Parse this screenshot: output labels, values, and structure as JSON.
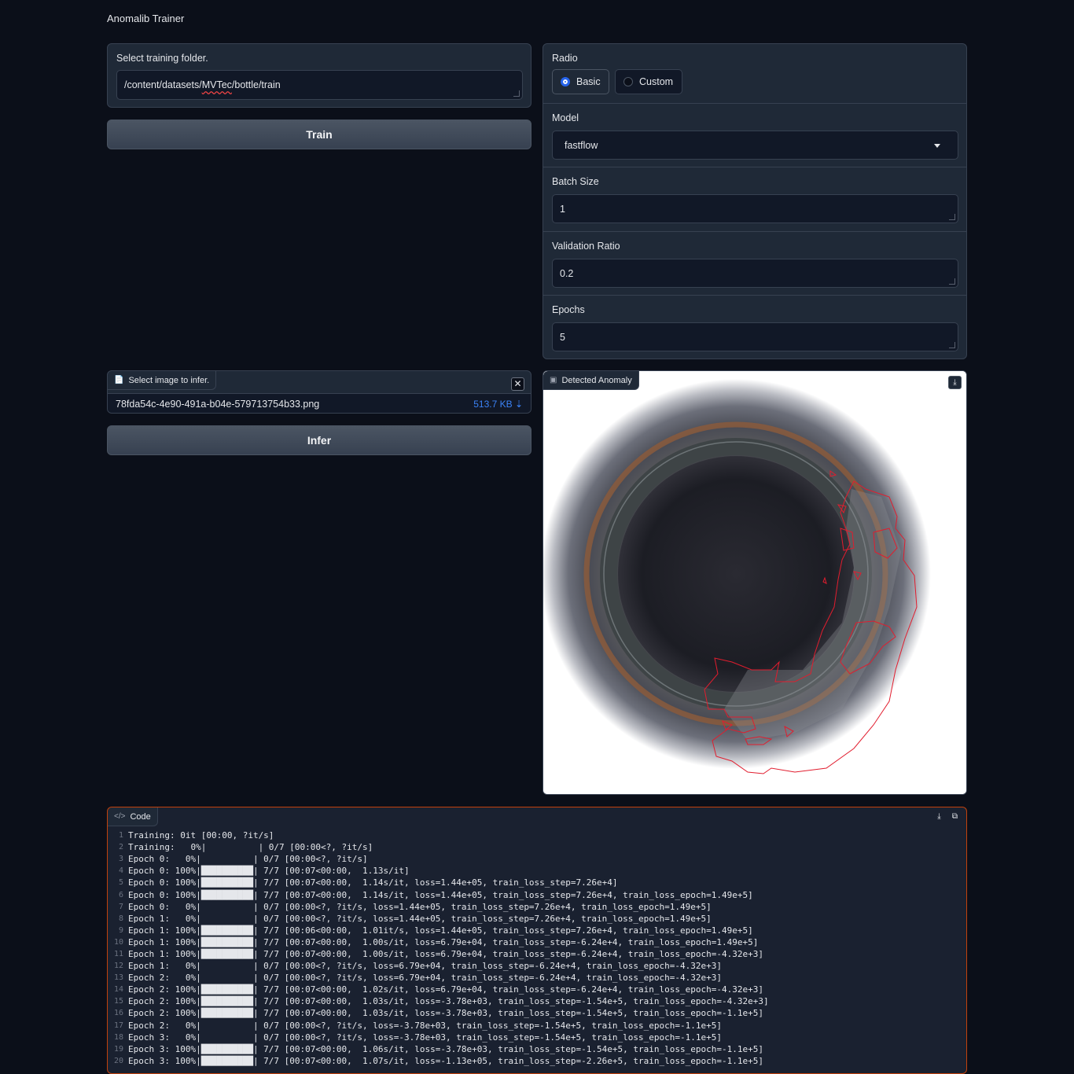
{
  "app": {
    "title": "Anomalib Trainer"
  },
  "train": {
    "folder_label": "Select training folder.",
    "folder_value_prefix": "/content/datasets/",
    "folder_value_spell": "MVTec",
    "folder_value_suffix": "/bottle/train",
    "train_button": "Train"
  },
  "settings": {
    "radio_label": "Radio",
    "radio_options": [
      "Basic",
      "Custom"
    ],
    "radio_selected": "Basic",
    "model_label": "Model",
    "model_value": "fastflow",
    "batch_label": "Batch Size",
    "batch_value": "1",
    "val_label": "Validation Ratio",
    "val_value": "0.2",
    "epochs_label": "Epochs",
    "epochs_value": "5"
  },
  "infer": {
    "file_label": "Select image to infer.",
    "file_name": "78fda54c-4e90-491a-b04e-579713754b33.png",
    "file_size": "513.7 KB ⇣",
    "infer_button": "Infer"
  },
  "result": {
    "label": "Detected Anomaly"
  },
  "code": {
    "label": "Code",
    "lines": [
      "Training: 0it [00:00, ?it/s]",
      "Training:   0%|          | 0/7 [00:00<?, ?it/s]",
      "Epoch 0:   0%|          | 0/7 [00:00<?, ?it/s]",
      "Epoch 0: 100%|██████████| 7/7 [00:07<00:00,  1.13s/it]",
      "Epoch 0: 100%|██████████| 7/7 [00:07<00:00,  1.14s/it, loss=1.44e+05, train_loss_step=7.26e+4]",
      "Epoch 0: 100%|██████████| 7/7 [00:07<00:00,  1.14s/it, loss=1.44e+05, train_loss_step=7.26e+4, train_loss_epoch=1.49e+5]",
      "Epoch 0:   0%|          | 0/7 [00:00<?, ?it/s, loss=1.44e+05, train_loss_step=7.26e+4, train_loss_epoch=1.49e+5]",
      "Epoch 1:   0%|          | 0/7 [00:00<?, ?it/s, loss=1.44e+05, train_loss_step=7.26e+4, train_loss_epoch=1.49e+5]",
      "Epoch 1: 100%|██████████| 7/7 [00:06<00:00,  1.01it/s, loss=1.44e+05, train_loss_step=7.26e+4, train_loss_epoch=1.49e+5]",
      "Epoch 1: 100%|██████████| 7/7 [00:07<00:00,  1.00s/it, loss=6.79e+04, train_loss_step=-6.24e+4, train_loss_epoch=1.49e+5]",
      "Epoch 1: 100%|██████████| 7/7 [00:07<00:00,  1.00s/it, loss=6.79e+04, train_loss_step=-6.24e+4, train_loss_epoch=-4.32e+3]",
      "Epoch 1:   0%|          | 0/7 [00:00<?, ?it/s, loss=6.79e+04, train_loss_step=-6.24e+4, train_loss_epoch=-4.32e+3]",
      "Epoch 2:   0%|          | 0/7 [00:00<?, ?it/s, loss=6.79e+04, train_loss_step=-6.24e+4, train_loss_epoch=-4.32e+3]",
      "Epoch 2: 100%|██████████| 7/7 [00:07<00:00,  1.02s/it, loss=6.79e+04, train_loss_step=-6.24e+4, train_loss_epoch=-4.32e+3]",
      "Epoch 2: 100%|██████████| 7/7 [00:07<00:00,  1.03s/it, loss=-3.78e+03, train_loss_step=-1.54e+5, train_loss_epoch=-4.32e+3]",
      "Epoch 2: 100%|██████████| 7/7 [00:07<00:00,  1.03s/it, loss=-3.78e+03, train_loss_step=-1.54e+5, train_loss_epoch=-1.1e+5]",
      "Epoch 2:   0%|          | 0/7 [00:00<?, ?it/s, loss=-3.78e+03, train_loss_step=-1.54e+5, train_loss_epoch=-1.1e+5]",
      "Epoch 3:   0%|          | 0/7 [00:00<?, ?it/s, loss=-3.78e+03, train_loss_step=-1.54e+5, train_loss_epoch=-1.1e+5]",
      "Epoch 3: 100%|██████████| 7/7 [00:07<00:00,  1.06s/it, loss=-3.78e+03, train_loss_step=-1.54e+5, train_loss_epoch=-1.1e+5]",
      "Epoch 3: 100%|██████████| 7/7 [00:07<00:00,  1.07s/it, loss=-1.13e+05, train_loss_step=-2.26e+5, train_loss_epoch=-1.1e+5]"
    ]
  },
  "colors": {
    "accent": "#2563eb",
    "code_border": "#c2410c",
    "anomaly_contour": "#e11d2e",
    "file_size": "#3b82f6"
  },
  "icons": [
    "file-icon",
    "close-icon",
    "image-icon",
    "download-icon",
    "code-icon",
    "copy-icon",
    "chevron-down-icon"
  ]
}
